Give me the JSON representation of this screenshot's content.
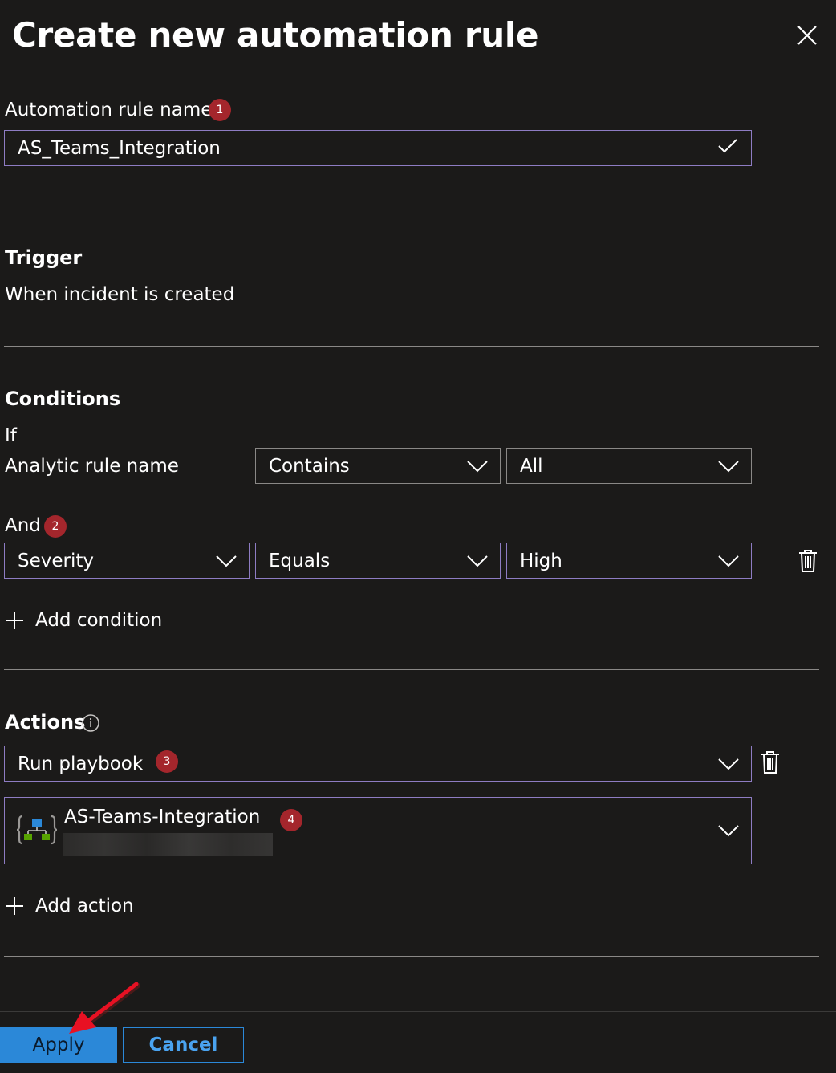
{
  "title": "Create new automation rule",
  "rule_name": {
    "label": "Automation rule name",
    "badge": "1",
    "value": "AS_Teams_Integration"
  },
  "trigger": {
    "heading": "Trigger",
    "value": "When incident is created"
  },
  "conditions": {
    "heading": "Conditions",
    "if_label": "If",
    "row1": {
      "field": "Analytic rule name",
      "operator": "Contains",
      "value": "All"
    },
    "and_label": "And",
    "and_badge": "2",
    "row2": {
      "field": "Severity",
      "operator": "Equals",
      "value": "High"
    },
    "add_label": "Add condition"
  },
  "actions": {
    "heading": "Actions",
    "action_type": "Run playbook",
    "badge3": "3",
    "playbook_name": "AS-Teams-Integration",
    "badge4": "4",
    "add_label": "Add action"
  },
  "footer": {
    "apply_label": "Apply",
    "cancel_label": "Cancel"
  },
  "colors": {
    "background": "#1b1a19",
    "focus_border": "#8e7cc3",
    "badge": "#a4262c",
    "primary": "#2b88d8",
    "arrow": "#e81123"
  }
}
